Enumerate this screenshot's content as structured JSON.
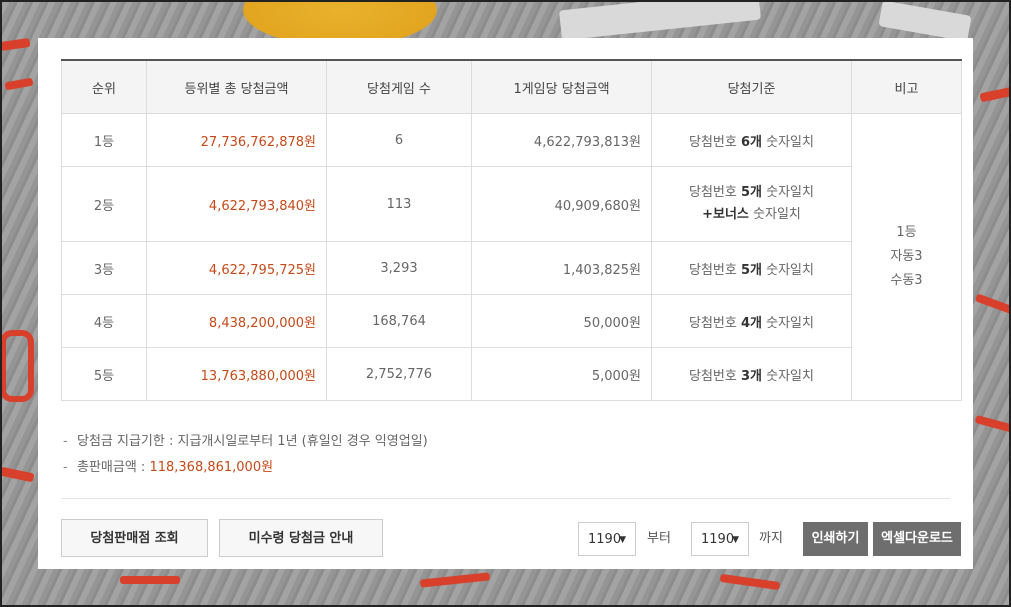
{
  "table": {
    "headers": [
      "순위",
      "등위별 총 당첨금액",
      "당첨게임 수",
      "1게임당 당첨금액",
      "당첨기준",
      "비고"
    ],
    "rows": [
      {
        "rank": "1등",
        "total": "27,736,762,878원",
        "games": "6",
        "per_game": "4,622,793,813원",
        "crit_pre": "당첨번호 ",
        "crit_bold": "6개",
        "crit_post": " 숫자일치",
        "crit_line2_bold": "",
        "crit_line2": ""
      },
      {
        "rank": "2등",
        "total": "4,622,793,840원",
        "games": "113",
        "per_game": "40,909,680원",
        "crit_pre": "당첨번호 ",
        "crit_bold": "5개",
        "crit_post": " 숫자일치",
        "crit_line2_bold": "+보너스",
        "crit_line2": " 숫자일치"
      },
      {
        "rank": "3등",
        "total": "4,622,795,725원",
        "games": "3,293",
        "per_game": "1,403,825원",
        "crit_pre": "당첨번호 ",
        "crit_bold": "5개",
        "crit_post": " 숫자일치",
        "crit_line2_bold": "",
        "crit_line2": ""
      },
      {
        "rank": "4등",
        "total": "8,438,200,000원",
        "games": "168,764",
        "per_game": "50,000원",
        "crit_pre": "당첨번호 ",
        "crit_bold": "4개",
        "crit_post": " 숫자일치",
        "crit_line2_bold": "",
        "crit_line2": ""
      },
      {
        "rank": "5등",
        "total": "13,763,880,000원",
        "games": "2,752,776",
        "per_game": "5,000원",
        "crit_pre": "당첨번호 ",
        "crit_bold": "3개",
        "crit_post": " 숫자일치",
        "crit_line2_bold": "",
        "crit_line2": ""
      }
    ],
    "remark": [
      "1등",
      "자동3",
      "수동3"
    ]
  },
  "notes": {
    "dash": "-",
    "deadline": "당첨금 지급기한 : 지급개시일로부터 1년 (휴일인 경우 익영업일)",
    "sales_label": "총판매금액 : ",
    "sales_value": "118,368,861,000원"
  },
  "actions": {
    "store_button": "당첨판매점 조회",
    "unclaimed_button": "미수령 당첨금 안내",
    "from_value": "1190",
    "from_label": "부터",
    "to_value": "1190",
    "to_label": "까지",
    "dropdown_icon": "triangle-down",
    "print_button": "인쇄하기",
    "excel_button": "엑셀다운로드"
  },
  "colors": {
    "accent": "#c54a19",
    "dark_button": "#6e6e6e"
  }
}
